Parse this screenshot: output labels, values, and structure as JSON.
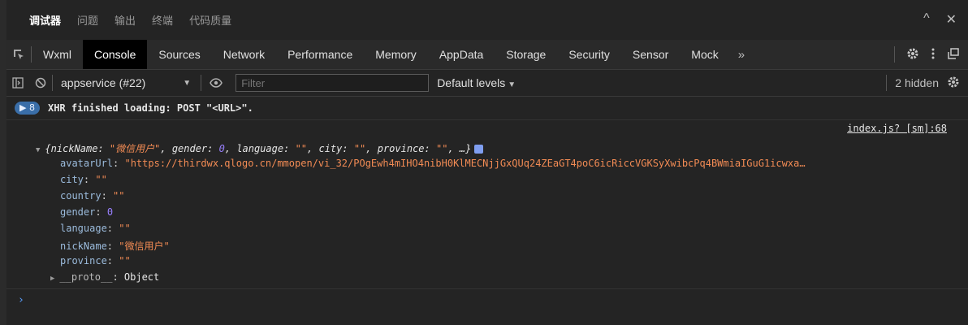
{
  "top_tabs": [
    "调试器",
    "问题",
    "输出",
    "终端",
    "代码质量"
  ],
  "top_actions": {
    "collapse": "^",
    "close": "✕"
  },
  "devtools_tabs": [
    "Wxml",
    "Console",
    "Sources",
    "Network",
    "Performance",
    "Memory",
    "AppData",
    "Storage",
    "Security",
    "Sensor",
    "Mock"
  ],
  "active_tab": "Console",
  "more_tabs": "»",
  "toolbar": {
    "context": "appservice (#22)",
    "filter_placeholder": "Filter",
    "levels": "Default levels",
    "hidden": "2 hidden"
  },
  "console": {
    "xhr_badge": "8",
    "xhr_message": "XHR finished loading: POST \"<URL>\".",
    "source": "index.js? [sm]:68",
    "summary": {
      "k1": "nickName",
      "v1": "\"微信用户\"",
      "k2": "gender",
      "v2": "0",
      "k3": "language",
      "v3": "\"\"",
      "k4": "city",
      "v4": "\"\"",
      "k5": "province",
      "v5": "\"\"",
      "tail": ", …}"
    },
    "props": [
      {
        "key": "avatarUrl",
        "value": "\"https://thirdwx.qlogo.cn/mmopen/vi_32/POgEwh4mIHO4nibH0KlMECNjjGxQUq24ZEaGT4poC6icRiccVGKSyXwibcPq4BWmiaIGuG1icwxa…",
        "type": "str"
      },
      {
        "key": "city",
        "value": "\"\"",
        "type": "str"
      },
      {
        "key": "country",
        "value": "\"\"",
        "type": "str"
      },
      {
        "key": "gender",
        "value": "0",
        "type": "num"
      },
      {
        "key": "language",
        "value": "\"\"",
        "type": "str"
      },
      {
        "key": "nickName",
        "value": "\"微信用户\"",
        "type": "str"
      },
      {
        "key": "province",
        "value": "\"\"",
        "type": "str"
      }
    ],
    "proto_key": "__proto__",
    "proto_value": "Object",
    "prompt": "›"
  }
}
